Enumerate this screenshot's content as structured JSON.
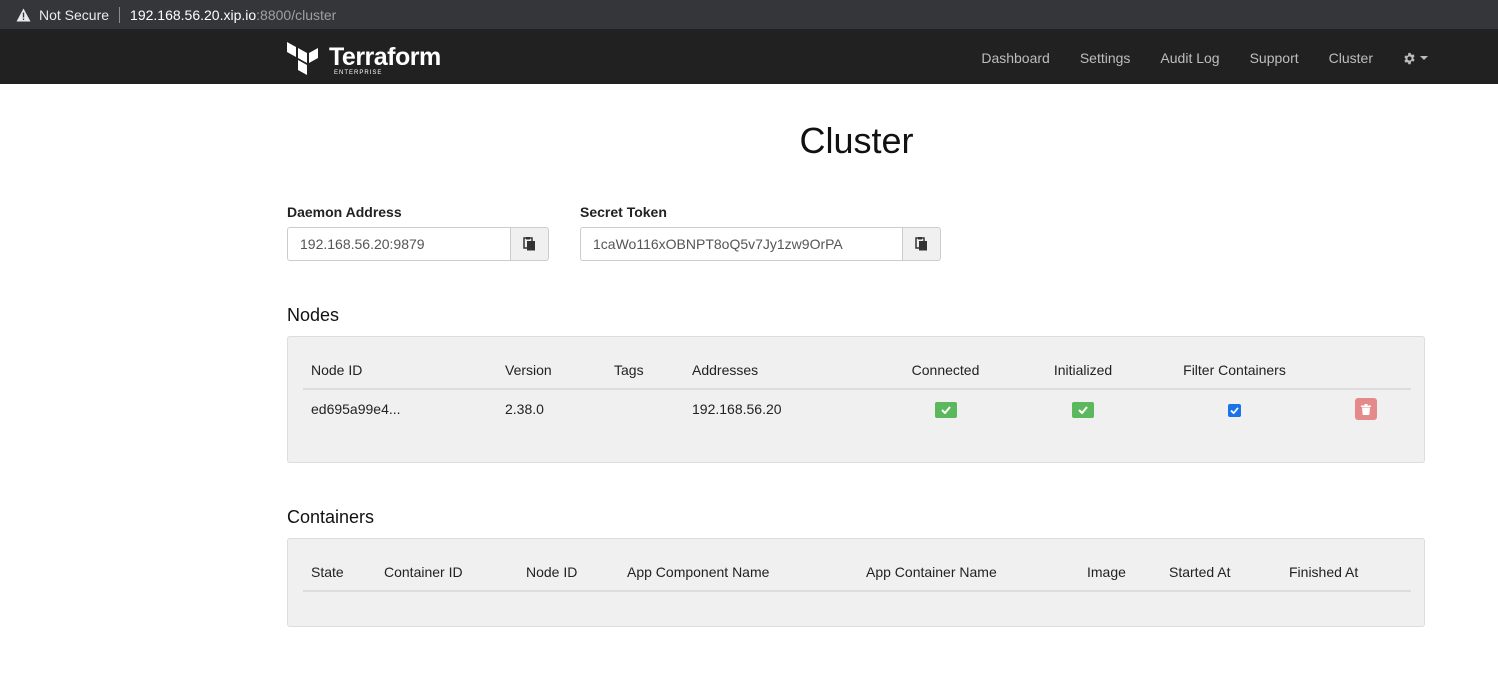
{
  "browser": {
    "security_label": "Not Secure",
    "url_host": "192.168.56.20.xip.io",
    "url_path": ":8800/cluster"
  },
  "brand": {
    "name": "Terraform",
    "subtitle": "ENTERPRISE"
  },
  "nav": {
    "items": [
      "Dashboard",
      "Settings",
      "Audit Log",
      "Support",
      "Cluster"
    ],
    "settings_icon": "gear-icon"
  },
  "page": {
    "title": "Cluster"
  },
  "daemon": {
    "label": "Daemon Address",
    "value": "192.168.56.20:9879"
  },
  "token": {
    "label": "Secret Token",
    "value": "1caWo116xOBNPT8oQ5v7Jy1zw9OrPA"
  },
  "nodes": {
    "heading": "Nodes",
    "columns": [
      "Node ID",
      "Version",
      "Tags",
      "Addresses",
      "Connected",
      "Initialized",
      "Filter Containers"
    ],
    "rows": [
      {
        "node_id": "ed695a99e4...",
        "version": "2.38.0",
        "tags": "",
        "addresses": "192.168.56.20",
        "connected": true,
        "initialized": true,
        "filter_containers": true
      }
    ]
  },
  "containers": {
    "heading": "Containers",
    "columns": [
      "State",
      "Container ID",
      "Node ID",
      "App Component Name",
      "App Container Name",
      "Image",
      "Started At",
      "Finished At"
    ],
    "rows": []
  },
  "colors": {
    "navbar": "#212121",
    "success": "#5cb85c",
    "danger": "#e58a8a",
    "checkbox": "#1a73e8",
    "panel": "#f0f0f0"
  }
}
